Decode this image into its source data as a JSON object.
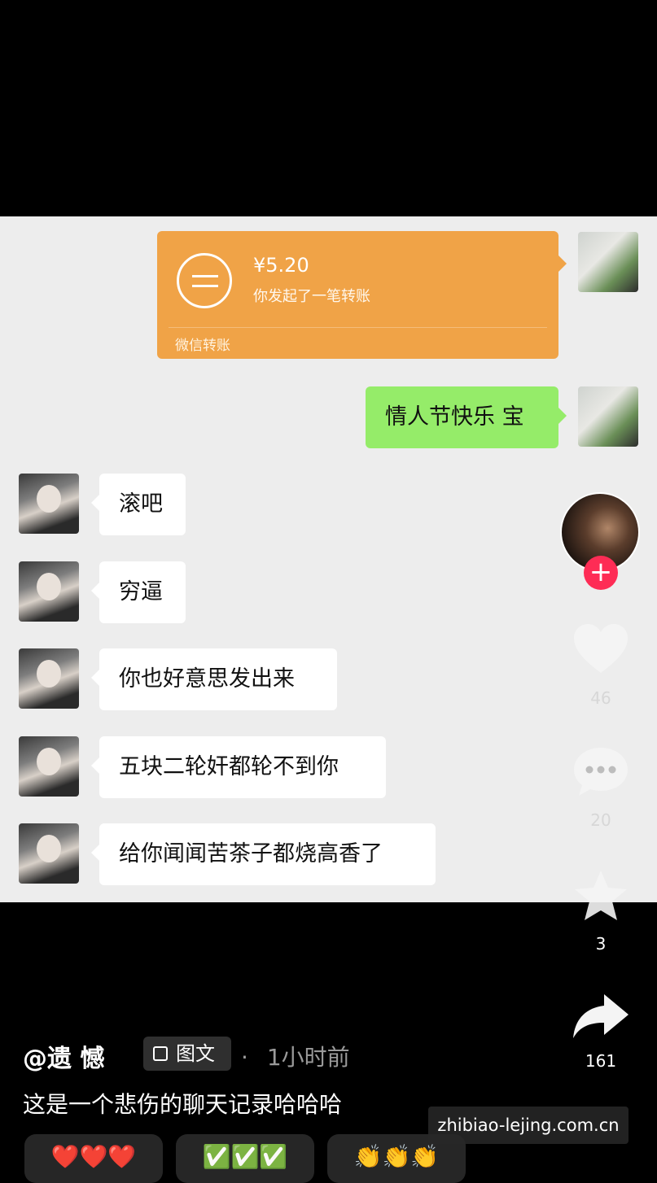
{
  "transfer": {
    "amount": "¥5.20",
    "description": "你发起了一笔转账",
    "footer": "微信转账"
  },
  "messages": [
    {
      "side": "me",
      "text": "情人节快乐 宝"
    },
    {
      "side": "her",
      "text": "滚吧"
    },
    {
      "side": "her",
      "text": "穷逼"
    },
    {
      "side": "her",
      "text": "你也好意思发出来"
    },
    {
      "side": "her",
      "text": "五块二轮奸都轮不到你"
    },
    {
      "side": "her",
      "text": "给你闻闻苦茶子都烧高香了"
    }
  ],
  "rail": {
    "follow_label": "+",
    "likes": "46",
    "comments": "20",
    "favorites": "3",
    "shares": "161"
  },
  "post": {
    "author": "@遗 憾",
    "tag_label": "图文",
    "separator": "·",
    "time": "1小时前",
    "caption": "这是一个悲伤的聊天记录哈哈哈"
  },
  "chips": [
    {
      "label": "❤️❤️❤️"
    },
    {
      "label": "✅✅✅"
    },
    {
      "label": "👏👏👏"
    }
  ],
  "watermark": "zhibiao-lejing.com.cn",
  "colors": {
    "transfer_bg": "#f0a347",
    "sent_bubble": "#95ec69",
    "follow_button": "#fe2c55",
    "chat_bg": "#ededed"
  }
}
